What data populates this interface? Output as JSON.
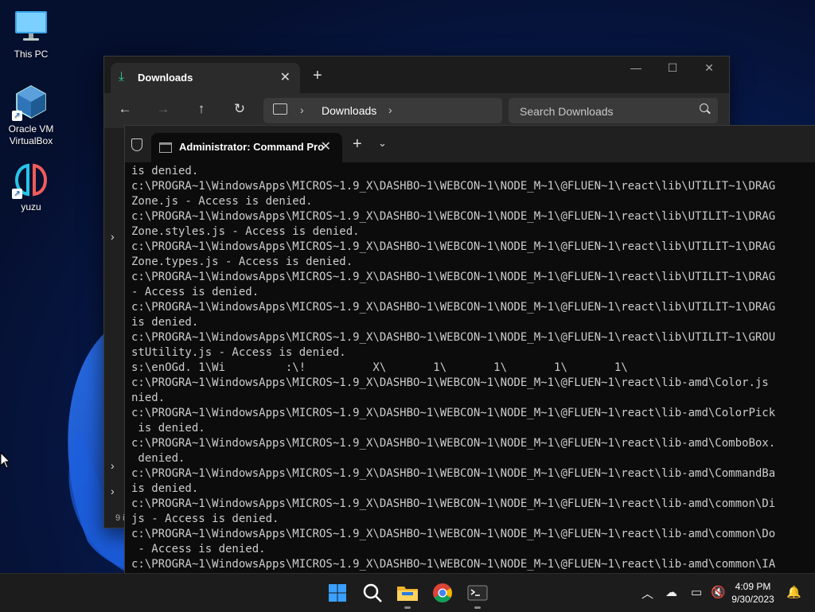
{
  "desktop": {
    "icons": [
      {
        "label": "This PC"
      },
      {
        "label": "Oracle VM VirtualBox"
      },
      {
        "label": "yuzu"
      }
    ]
  },
  "explorer": {
    "tab_title": "Downloads",
    "breadcrumb": "Downloads",
    "search_placeholder": "Search Downloads",
    "status_prefix": "9 i"
  },
  "terminal": {
    "tab_title": "Administrator: Command Pro",
    "lines": [
      "is denied.",
      "c:\\PROGRA~1\\WindowsApps\\MICROS~1.9_X\\DASHBO~1\\WEBCON~1\\NODE_M~1\\@FLUEN~1\\react\\lib\\UTILIT~1\\DRAG",
      "Zone.js - Access is denied.",
      "c:\\PROGRA~1\\WindowsApps\\MICROS~1.9_X\\DASHBO~1\\WEBCON~1\\NODE_M~1\\@FLUEN~1\\react\\lib\\UTILIT~1\\DRAG",
      "Zone.styles.js - Access is denied.",
      "c:\\PROGRA~1\\WindowsApps\\MICROS~1.9_X\\DASHBO~1\\WEBCON~1\\NODE_M~1\\@FLUEN~1\\react\\lib\\UTILIT~1\\DRAG",
      "Zone.types.js - Access is denied.",
      "c:\\PROGRA~1\\WindowsApps\\MICROS~1.9_X\\DASHBO~1\\WEBCON~1\\NODE_M~1\\@FLUEN~1\\react\\lib\\UTILIT~1\\DRAG",
      "- Access is denied.",
      "c:\\PROGRA~1\\WindowsApps\\MICROS~1.9_X\\DASHBO~1\\WEBCON~1\\NODE_M~1\\@FLUEN~1\\react\\lib\\UTILIT~1\\DRAG",
      "is denied.",
      "c:\\PROGRA~1\\WindowsApps\\MICROS~1.9_X\\DASHBO~1\\WEBCON~1\\NODE_M~1\\@FLUEN~1\\react\\lib\\UTILIT~1\\GROU",
      "stUtility.js - Access is denied.",
      "s:\\enOGd. 1\\Wi         :\\!          X\\       1\\       1\\       1\\       1\\",
      "c:\\PROGRA~1\\WindowsApps\\MICROS~1.9_X\\DASHBO~1\\WEBCON~1\\NODE_M~1\\@FLUEN~1\\react\\lib-amd\\Color.js",
      "nied.",
      "c:\\PROGRA~1\\WindowsApps\\MICROS~1.9_X\\DASHBO~1\\WEBCON~1\\NODE_M~1\\@FLUEN~1\\react\\lib-amd\\ColorPick",
      " is denied.",
      "c:\\PROGRA~1\\WindowsApps\\MICROS~1.9_X\\DASHBO~1\\WEBCON~1\\NODE_M~1\\@FLUEN~1\\react\\lib-amd\\ComboBox.",
      " denied.",
      "c:\\PROGRA~1\\WindowsApps\\MICROS~1.9_X\\DASHBO~1\\WEBCON~1\\NODE_M~1\\@FLUEN~1\\react\\lib-amd\\CommandBa",
      "is denied.",
      "c:\\PROGRA~1\\WindowsApps\\MICROS~1.9_X\\DASHBO~1\\WEBCON~1\\NODE_M~1\\@FLUEN~1\\react\\lib-amd\\common\\Di",
      "js - Access is denied.",
      "c:\\PROGRA~1\\WindowsApps\\MICROS~1.9_X\\DASHBO~1\\WEBCON~1\\NODE_M~1\\@FLUEN~1\\react\\lib-amd\\common\\Do",
      " - Access is denied.",
      "c:\\PROGRA~1\\WindowsApps\\MICROS~1.9_X\\DASHBO~1\\WEBCON~1\\NODE_M~1\\@FLUEN~1\\react\\lib-amd\\common\\IA"
    ]
  },
  "taskbar": {
    "time": "4:09 PM",
    "date": "9/30/2023"
  }
}
